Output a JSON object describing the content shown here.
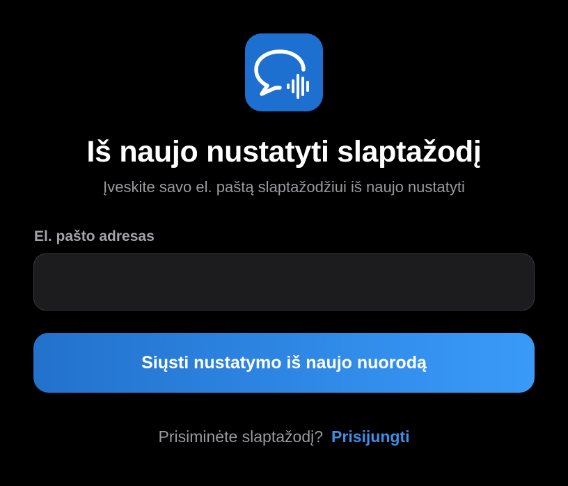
{
  "app_icon": {
    "icon": "speech-bubble-waveform-icon",
    "background_color": "#1d6fd0"
  },
  "header": {
    "title": "Iš naujo nustatyti slaptažodį",
    "subtitle": "Įveskite savo el. paštą slaptažodžiui iš naujo nustatyti"
  },
  "form": {
    "email_label": "El. pašto adresas",
    "email_value": "",
    "email_placeholder": "",
    "submit_label": "Siųsti nustatymo iš naujo nuorodą",
    "submit_color": "#2f88e6"
  },
  "footer": {
    "question": "Prisiminėte slaptažodį?",
    "login_link": "Prisijungti",
    "link_color": "#3d8ee6"
  }
}
